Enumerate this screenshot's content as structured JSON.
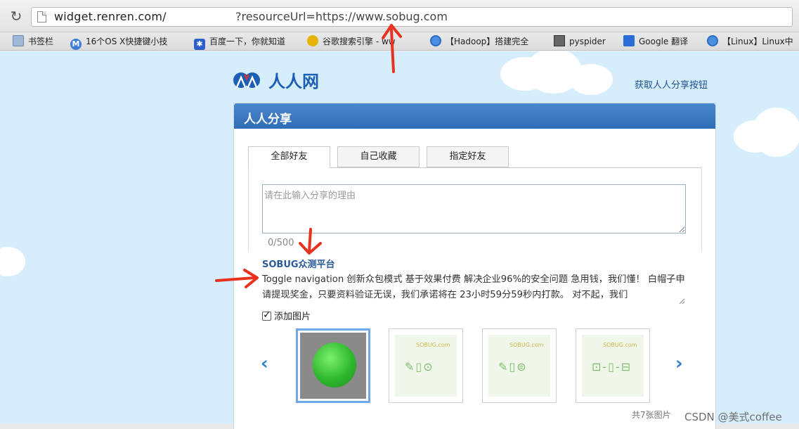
{
  "browser": {
    "url_host": "widget.renren.com/",
    "url_query": "?resourceUrl=https://www.sobug.com",
    "bookmarks": [
      {
        "label": "书签栏",
        "icon": "folder-icon"
      },
      {
        "label": "16个OS X快捷键小技",
        "icon": "m-site-icon"
      },
      {
        "label": "百度一下，你就知道",
        "icon": "baidu-paw-icon"
      },
      {
        "label": "谷歌搜索引擎 - ww",
        "icon": "google-doodle-icon"
      },
      {
        "label": "【Hadoop】搭建完全",
        "icon": "csdn-circle-icon"
      },
      {
        "label": "pyspider",
        "icon": "book-icon"
      },
      {
        "label": "Google 翻译",
        "icon": "google-translate-icon"
      },
      {
        "label": "【Linux】Linux中",
        "icon": "csdn-circle-icon"
      }
    ]
  },
  "header": {
    "logo_text": "人人网",
    "share_button_link": "获取人人分享按钮"
  },
  "panel": {
    "title": "人人分享",
    "tabs": [
      "全部好友",
      "自己收藏",
      "指定好友"
    ],
    "reason_placeholder": "请在此输入分享的理由",
    "counter": "0/500",
    "share_title": "SOBUG众测平台",
    "share_description": "Toggle navigation  创新众包模式  基于效果付费 解决企业96%的安全问题 急用钱，我们懂！ 白帽子申请提现奖金，只要资料验证无误，我们承诺将在 23小时59分59秒内打款。 对不起，我们",
    "add_image_label": "添加图片",
    "image_count": "共7张图片",
    "mini_logo_text": "SOBUG.com"
  },
  "watermark": "CSDN @美式coffee",
  "colors": {
    "page_bg": "#d6eefc",
    "panel_header": "#2f6db6",
    "link": "#1d4f8f",
    "annotation_arrow": "#e8321e"
  }
}
